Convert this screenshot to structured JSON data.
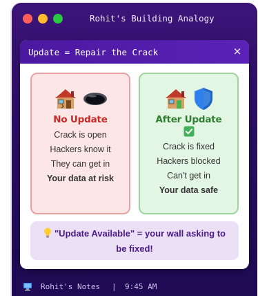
{
  "window": {
    "title": "Rohit's Building Analogy",
    "controls": {
      "close_color": "#ff5f57",
      "minimize_color": "#ffbd2e",
      "maximize_color": "#28c840"
    }
  },
  "dialog": {
    "title": "Update = Repair the Crack",
    "close_symbol": "×",
    "panels": [
      {
        "id": "no-update",
        "icons": [
          "house-icon",
          "hole-icon"
        ],
        "title": "No Update",
        "lines": [
          "Crack is open",
          "Hackers know it",
          "They can get in",
          "Your data at risk"
        ],
        "accent": "#c62828"
      },
      {
        "id": "after-update",
        "icons": [
          "house-icon",
          "shield-icon",
          "check-icon"
        ],
        "title": "After Update",
        "lines": [
          "Crack is fixed",
          "Hackers blocked",
          "Can't get in",
          "Your data safe"
        ],
        "accent": "#2e7d32"
      }
    ],
    "banner": {
      "icon": "lightbulb-icon",
      "text": "\"Update Available\" = your wall asking to be fixed!"
    }
  },
  "statusbar": {
    "icon": "computer-icon",
    "notes_label": "Rohit's Notes",
    "separator": "|",
    "time": "9:45 AM"
  }
}
